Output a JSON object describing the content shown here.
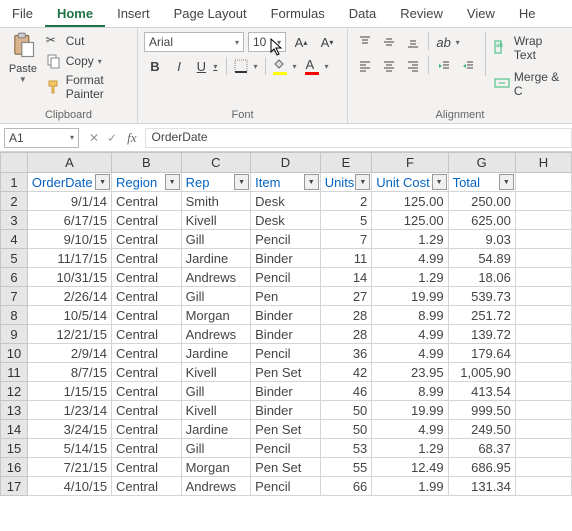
{
  "tabs": [
    "File",
    "Home",
    "Insert",
    "Page Layout",
    "Formulas",
    "Data",
    "Review",
    "View",
    "He"
  ],
  "activeTab": 1,
  "clipboard": {
    "paste": "Paste",
    "cut": "Cut",
    "copy": "Copy",
    "format_painter": "Format Painter",
    "label": "Clipboard"
  },
  "font": {
    "family": "Arial",
    "size": "10",
    "bold": "B",
    "italic": "I",
    "underline": "U",
    "font_color_letter": "A",
    "label": "Font"
  },
  "alignment": {
    "wrap": "Wrap Text",
    "merge": "Merge & C",
    "label": "Alignment"
  },
  "namebox": "A1",
  "fx": "fx",
  "formula_value": "OrderDate",
  "columns": [
    "A",
    "B",
    "C",
    "D",
    "E",
    "F",
    "G",
    "H"
  ],
  "headers": [
    "OrderDate",
    "Region",
    "Rep",
    "Item",
    "Units",
    "Unit Cost",
    "Total"
  ],
  "rows": [
    {
      "n": 2,
      "d": "9/1/14",
      "reg": "Central",
      "rep": "Smith",
      "item": "Desk",
      "u": "2",
      "uc": "125.00",
      "t": "250.00"
    },
    {
      "n": 3,
      "d": "6/17/15",
      "reg": "Central",
      "rep": "Kivell",
      "item": "Desk",
      "u": "5",
      "uc": "125.00",
      "t": "625.00"
    },
    {
      "n": 4,
      "d": "9/10/15",
      "reg": "Central",
      "rep": "Gill",
      "item": "Pencil",
      "u": "7",
      "uc": "1.29",
      "t": "9.03"
    },
    {
      "n": 5,
      "d": "11/17/15",
      "reg": "Central",
      "rep": "Jardine",
      "item": "Binder",
      "u": "11",
      "uc": "4.99",
      "t": "54.89"
    },
    {
      "n": 6,
      "d": "10/31/15",
      "reg": "Central",
      "rep": "Andrews",
      "item": "Pencil",
      "u": "14",
      "uc": "1.29",
      "t": "18.06"
    },
    {
      "n": 7,
      "d": "2/26/14",
      "reg": "Central",
      "rep": "Gill",
      "item": "Pen",
      "u": "27",
      "uc": "19.99",
      "t": "539.73"
    },
    {
      "n": 8,
      "d": "10/5/14",
      "reg": "Central",
      "rep": "Morgan",
      "item": "Binder",
      "u": "28",
      "uc": "8.99",
      "t": "251.72"
    },
    {
      "n": 9,
      "d": "12/21/15",
      "reg": "Central",
      "rep": "Andrews",
      "item": "Binder",
      "u": "28",
      "uc": "4.99",
      "t": "139.72"
    },
    {
      "n": 10,
      "d": "2/9/14",
      "reg": "Central",
      "rep": "Jardine",
      "item": "Pencil",
      "u": "36",
      "uc": "4.99",
      "t": "179.64"
    },
    {
      "n": 11,
      "d": "8/7/15",
      "reg": "Central",
      "rep": "Kivell",
      "item": "Pen Set",
      "u": "42",
      "uc": "23.95",
      "t": "1,005.90"
    },
    {
      "n": 12,
      "d": "1/15/15",
      "reg": "Central",
      "rep": "Gill",
      "item": "Binder",
      "u": "46",
      "uc": "8.99",
      "t": "413.54"
    },
    {
      "n": 13,
      "d": "1/23/14",
      "reg": "Central",
      "rep": "Kivell",
      "item": "Binder",
      "u": "50",
      "uc": "19.99",
      "t": "999.50"
    },
    {
      "n": 14,
      "d": "3/24/15",
      "reg": "Central",
      "rep": "Jardine",
      "item": "Pen Set",
      "u": "50",
      "uc": "4.99",
      "t": "249.50"
    },
    {
      "n": 15,
      "d": "5/14/15",
      "reg": "Central",
      "rep": "Gill",
      "item": "Pencil",
      "u": "53",
      "uc": "1.29",
      "t": "68.37"
    },
    {
      "n": 16,
      "d": "7/21/15",
      "reg": "Central",
      "rep": "Morgan",
      "item": "Pen Set",
      "u": "55",
      "uc": "12.49",
      "t": "686.95"
    },
    {
      "n": 17,
      "d": "4/10/15",
      "reg": "Central",
      "rep": "Andrews",
      "item": "Pencil",
      "u": "66",
      "uc": "1.99",
      "t": "131.34"
    }
  ]
}
